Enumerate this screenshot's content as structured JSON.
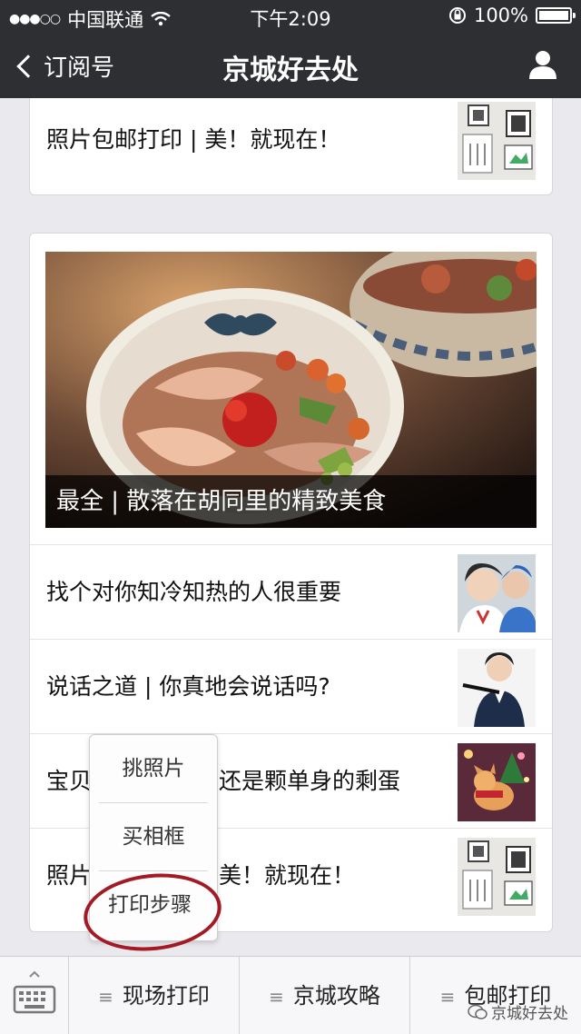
{
  "status_bar": {
    "carrier": "中国联通",
    "time": "下午2:09",
    "battery": "100%"
  },
  "nav": {
    "back_label": "订阅号",
    "title": "京城好去处"
  },
  "card_top": {
    "item": {
      "title": "照片包邮打印 | 美！就现在！",
      "thumb_icon": "frames-photo"
    }
  },
  "card_main": {
    "hero_title": "最全 | 散落在胡同里的精致美食",
    "items": [
      {
        "title": "找个对你知冷知热的人很重要",
        "thumb_icon": "people-photo"
      },
      {
        "title": "说话之道 | 你真地会说话吗?",
        "thumb_icon": "man-photo"
      },
      {
        "title": "宝贝还是颗单身的剩蛋",
        "title_visible_left": "宝贝",
        "title_visible_right": "还是颗单身的剩蛋",
        "thumb_icon": "dog-photo"
      },
      {
        "title": "照片包邮打印 | 美！就现在！",
        "title_visible_left": "照片",
        "title_visible_right": "美！就现在！",
        "thumb_icon": "frames-photo"
      }
    ]
  },
  "popup_menu": {
    "items": [
      "挑照片",
      "买相框",
      "打印步骤"
    ]
  },
  "bottom_menu": {
    "items": [
      "现场打印",
      "京城攻略",
      "包邮打印"
    ]
  },
  "watermark": "京城好去处",
  "colors": {
    "header_bg": "#2e2f33",
    "circle_mark": "#a41a24"
  }
}
